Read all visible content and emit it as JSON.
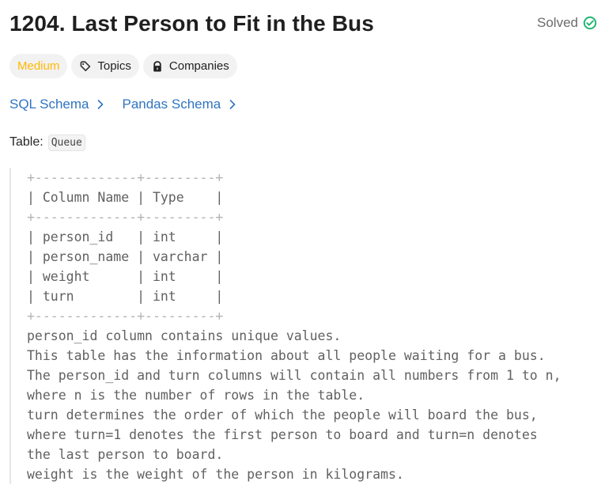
{
  "header": {
    "title": "1204. Last Person to Fit in the Bus",
    "status": "Solved"
  },
  "tags": {
    "difficulty": "Medium",
    "topics": "Topics",
    "companies": "Companies"
  },
  "schemas": {
    "sql": "SQL Schema",
    "pandas": "Pandas Schema"
  },
  "table_info": {
    "label": "Table:",
    "name": "Queue"
  },
  "ascii_table": {
    "border_top": "+-------------+---------+",
    "header_row": "| Column Name | Type    |",
    "border_mid": "+-------------+---------+",
    "rows": [
      "| person_id   | int     |",
      "| person_name | varchar |",
      "| weight      | int     |",
      "| turn        | int     |"
    ],
    "border_bottom": "+-------------+---------+"
  },
  "description_lines": [
    "person_id column contains unique values.",
    "This table has the information about all people waiting for a bus.",
    "The person_id and turn columns will contain all numbers from 1 to n,",
    "where n is the number of rows in the table.",
    "turn determines the order of which the people will board the bus,",
    "where turn=1 denotes the first person to board and turn=n denotes",
    "the last person to board.",
    "weight is the weight of the person in kilograms."
  ],
  "colors": {
    "medium": "#ffb800",
    "link": "#2f74c0",
    "solved_check": "#22b573"
  },
  "icons": {
    "solved": "check-circle-icon",
    "topics": "tag-icon",
    "companies": "lock-icon",
    "chevron": "chevron-right-icon"
  }
}
